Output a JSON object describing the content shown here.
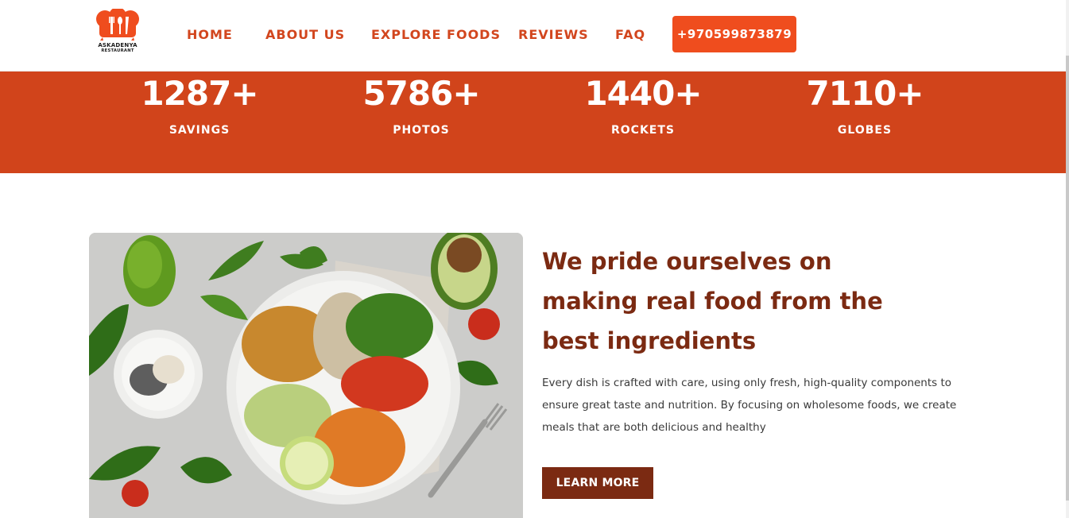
{
  "brand": {
    "line1": "ASKADENYA",
    "line2": "RESTAURANT"
  },
  "nav": {
    "items": [
      {
        "label": "HOME"
      },
      {
        "label": "ABOUT US"
      },
      {
        "label": "EXPLORE FOODS"
      },
      {
        "label": "REVIEWS"
      },
      {
        "label": "FAQ"
      }
    ],
    "phone": "+970599873879"
  },
  "stats": [
    {
      "value": "1287+",
      "label": "SAVINGS"
    },
    {
      "value": "5786+",
      "label": "PHOTOS"
    },
    {
      "value": "1440+",
      "label": "ROCKETS"
    },
    {
      "value": "7110+",
      "label": "GLOBES"
    }
  ],
  "feature": {
    "headline": [
      "We pride ourselves on",
      "making real food from the",
      "best ingredients"
    ],
    "body": [
      "Every dish is crafted with care, using only fresh, high-quality components to",
      "ensure great taste and nutrition. By focusing on wholesome foods, we create",
      "meals that are both delicious and healthy"
    ],
    "button_label": "LEARN MORE"
  },
  "colors": {
    "accent": "#d1441b",
    "button_orange": "#ef4d1e",
    "nav_text": "#d2461e",
    "dark_brown": "#7b2a12"
  },
  "icons": {
    "logo": "chef-hat-utensils-icon"
  }
}
